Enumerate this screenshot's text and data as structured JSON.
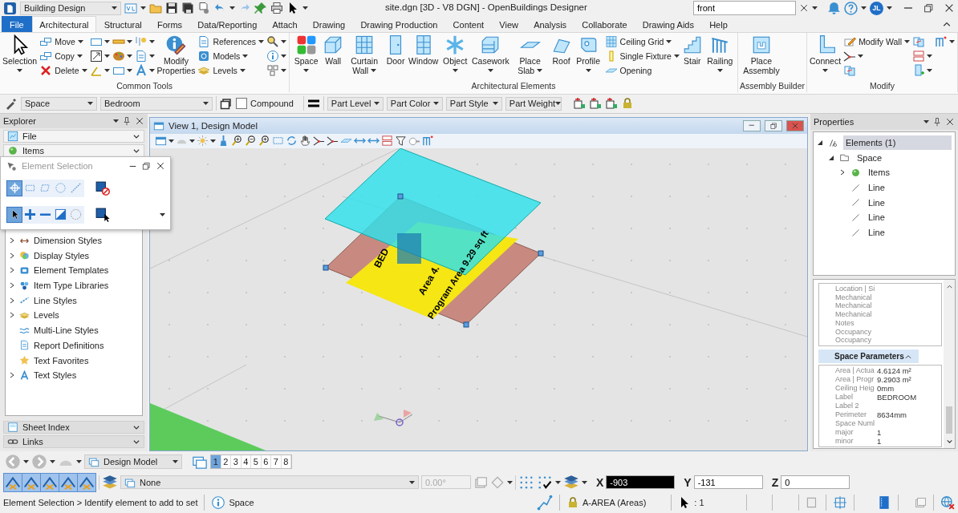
{
  "title_bar": {
    "workflow": "Building Design",
    "title": "site.dgn [3D - V8 DGN] - OpenBuildings Designer",
    "search": {
      "value": "front"
    },
    "user_initials": "JL"
  },
  "tabs": [
    {
      "label": "File",
      "kind": "file",
      "selected": false
    },
    {
      "label": "Architectural",
      "kind": "tab",
      "selected": true
    },
    {
      "label": "Structural",
      "kind": "tab",
      "selected": false
    },
    {
      "label": "Forms",
      "kind": "tab",
      "selected": false
    },
    {
      "label": "Data/Reporting",
      "kind": "tab",
      "selected": false
    },
    {
      "label": "Attach",
      "kind": "tab",
      "selected": false
    },
    {
      "label": "Drawing",
      "kind": "tab",
      "selected": false
    },
    {
      "label": "Drawing Production",
      "kind": "tab",
      "selected": false
    },
    {
      "label": "Content",
      "kind": "tab",
      "selected": false
    },
    {
      "label": "View",
      "kind": "tab",
      "selected": false
    },
    {
      "label": "Analysis",
      "kind": "tab",
      "selected": false
    },
    {
      "label": "Collaborate",
      "kind": "tab",
      "selected": false
    },
    {
      "label": "Drawing Aids",
      "kind": "tab",
      "selected": false
    },
    {
      "label": "Help",
      "kind": "tab",
      "selected": false
    }
  ],
  "ribbon_groups": [
    {
      "label": "Common Tools",
      "columns": [
        [
          {
            "kind": "large",
            "label": "Selection",
            "dropdown": true
          }
        ],
        [
          {
            "kind": "small",
            "label": "Move",
            "dropdown": true
          },
          {
            "kind": "small",
            "label": "Copy",
            "dropdown": true
          },
          {
            "kind": "small",
            "label": "Delete",
            "dropdown": true
          }
        ],
        [
          {
            "kind": "icon",
            "dropdown": true
          },
          {
            "kind": "icon",
            "dropdown": true
          },
          {
            "kind": "icon",
            "dropdown": true
          }
        ],
        [
          {
            "kind": "icon",
            "dropdown": true
          },
          {
            "kind": "icon",
            "dropdown": true
          },
          {
            "kind": "icon",
            "dropdown": true
          }
        ],
        [
          {
            "kind": "icon",
            "dropdown": true
          },
          {
            "kind": "icon",
            "dropdown": true
          },
          {
            "kind": "icon",
            "dropdown": true
          }
        ],
        [
          {
            "kind": "large",
            "label": "Modify Properties",
            "dropdown": false
          }
        ],
        [
          {
            "kind": "small",
            "label": "References",
            "dropdown": true
          },
          {
            "kind": "small",
            "label": "Models",
            "dropdown": true
          },
          {
            "kind": "small",
            "label": "Levels",
            "dropdown": true
          }
        ],
        [
          {
            "kind": "icon",
            "dropdown": true
          },
          {
            "kind": "icon",
            "dropdown": true
          },
          {
            "kind": "icon",
            "dropdown": true
          }
        ]
      ]
    },
    {
      "label": "Architectural Elements",
      "columns": [
        [
          {
            "kind": "large",
            "label": "Space",
            "dropdown": true
          }
        ],
        [
          {
            "kind": "large",
            "label": "Wall",
            "dropdown": false
          }
        ],
        [
          {
            "kind": "large",
            "label": "Curtain Wall",
            "dropdown": true
          }
        ],
        [
          {
            "kind": "large",
            "label": "Door",
            "dropdown": false
          }
        ],
        [
          {
            "kind": "large",
            "label": "Window",
            "dropdown": false
          }
        ],
        [
          {
            "kind": "large",
            "label": "Object",
            "dropdown": true
          }
        ],
        [
          {
            "kind": "large",
            "label": "Casework",
            "dropdown": true
          }
        ],
        [
          {
            "kind": "large",
            "label": "Place Slab",
            "dropdown": true
          }
        ],
        [
          {
            "kind": "large",
            "label": "Roof",
            "dropdown": false
          }
        ],
        [
          {
            "kind": "large",
            "label": "Profile",
            "dropdown": true
          }
        ],
        [
          {
            "kind": "small",
            "label": "Ceiling Grid",
            "dropdown": true
          },
          {
            "kind": "small",
            "label": "Single Fixture",
            "dropdown": true
          },
          {
            "kind": "small",
            "label": "Opening",
            "dropdown": false
          }
        ],
        [
          {
            "kind": "large",
            "label": "Stair",
            "dropdown": false
          }
        ],
        [
          {
            "kind": "large",
            "label": "Railing",
            "dropdown": true
          }
        ]
      ]
    },
    {
      "label": "Assembly Builder",
      "columns": [
        [
          {
            "kind": "large",
            "label": "Place Assembly",
            "dropdown": false
          }
        ]
      ]
    },
    {
      "label": "Modify",
      "columns": [
        [
          {
            "kind": "large",
            "label": "Connect",
            "dropdown": true
          }
        ],
        [
          {
            "kind": "small",
            "label": "Modify Wall",
            "dropdown": true
          },
          {
            "kind": "icon",
            "dropdown": true
          },
          {
            "kind": "icon",
            "dropdown": false
          }
        ],
        [
          {
            "kind": "icon",
            "dropdown": false
          },
          {
            "kind": "icon",
            "dropdown": true
          },
          {
            "kind": "icon",
            "dropdown": true
          }
        ],
        [
          {
            "kind": "icon",
            "dropdown": true
          }
        ]
      ]
    }
  ],
  "attributes_bar": {
    "type": "Space",
    "name": "Bedroom",
    "compound": {
      "label": "Compound",
      "checked": false
    },
    "part_fields": [
      "Part Level",
      "Part Color",
      "Part Style",
      "Part Weight"
    ]
  },
  "explorer": {
    "title": "Explorer",
    "sections_top": [
      "File",
      "Items"
    ],
    "tree": [
      {
        "label": "Dimension Styles",
        "expandable": true
      },
      {
        "label": "Display Styles",
        "expandable": true
      },
      {
        "label": "Element Templates",
        "expandable": true
      },
      {
        "label": "Item Type Libraries",
        "expandable": true
      },
      {
        "label": "Line Styles",
        "expandable": true
      },
      {
        "label": "Levels",
        "expandable": true
      },
      {
        "label": "Multi-Line Styles",
        "expandable": false
      },
      {
        "label": "Report Definitions",
        "expandable": false
      },
      {
        "label": "Text Favorites",
        "expandable": false
      },
      {
        "label": "Text Styles",
        "expandable": true
      }
    ],
    "sections_bottom": [
      "Sheet Index",
      "Links"
    ]
  },
  "selection_dialog": {
    "title": "Element Selection",
    "methods": [
      {
        "selected": true
      },
      {
        "selected": false
      },
      {
        "selected": false
      },
      {
        "selected": false
      },
      {
        "selected": false
      }
    ],
    "modes": [
      {
        "selected": true
      },
      {
        "selected": false
      },
      {
        "selected": false
      },
      {
        "selected": false
      },
      {
        "selected": false
      }
    ]
  },
  "view": {
    "title": "View 1, Design Model",
    "drawing_labels": [
      "BED",
      "Area 4.",
      "Program Area 9.29 sq ft"
    ]
  },
  "properties": {
    "title": "Properties",
    "tree": [
      {
        "label": "Elements (1)",
        "selected": true,
        "expanded": true,
        "children": [
          {
            "label": "Space",
            "selected": false,
            "expanded": true,
            "children": [
              {
                "label": "Items",
                "selected": false,
                "expanded": false
              },
              {
                "label": "Line",
                "selected": false
              },
              {
                "label": "Line",
                "selected": false
              },
              {
                "label": "Line",
                "selected": false
              },
              {
                "label": "Line",
                "selected": false
              }
            ]
          }
        ]
      }
    ],
    "property_rows": [
      "Location | Si",
      "Mechanical",
      "Mechanical",
      "Mechanical",
      "Notes",
      "Occupancy",
      "Occupancy"
    ],
    "space_parameters": {
      "title": "Space Parameters",
      "expanded": true,
      "rows": [
        {
          "label": "Area | Actua",
          "value": "4.6124 m²"
        },
        {
          "label": "Area | Progr",
          "value": "9.2903 m²"
        },
        {
          "label": "Ceiling Heig",
          "value": "0mm"
        },
        {
          "label": "Label",
          "value": "BEDROOM"
        },
        {
          "label": "Label 2"
        },
        {
          "label": "Perimeter",
          "value": "8634mm"
        },
        {
          "label": "Space Numl"
        },
        {
          "label": "major",
          "value": "1"
        },
        {
          "label": "minor",
          "value": "1"
        }
      ]
    }
  },
  "view_bar": {
    "model": "Design Model",
    "views": [
      {
        "label": "1",
        "selected": true
      },
      {
        "label": "2",
        "selected": false
      },
      {
        "label": "3",
        "selected": false
      },
      {
        "label": "4",
        "selected": false
      },
      {
        "label": "5",
        "selected": false
      },
      {
        "label": "6",
        "selected": false
      },
      {
        "label": "7",
        "selected": false
      },
      {
        "label": "8",
        "selected": false
      }
    ]
  },
  "snap_bar": {
    "level": "None",
    "angle": {
      "value": "0.00°",
      "disabled": true
    },
    "coordinates": [
      {
        "axis": "X",
        "value": "-903",
        "selected": true
      },
      {
        "axis": "Y",
        "value": "-131",
        "selected": false
      },
      {
        "axis": "Z",
        "value": "0",
        "selected": false
      }
    ]
  },
  "status_bar": {
    "message": "Element Selection > Identify element to add to set",
    "element_type": "Space",
    "level": "A-AREA (Areas)",
    "selection_count": ": 1"
  }
}
